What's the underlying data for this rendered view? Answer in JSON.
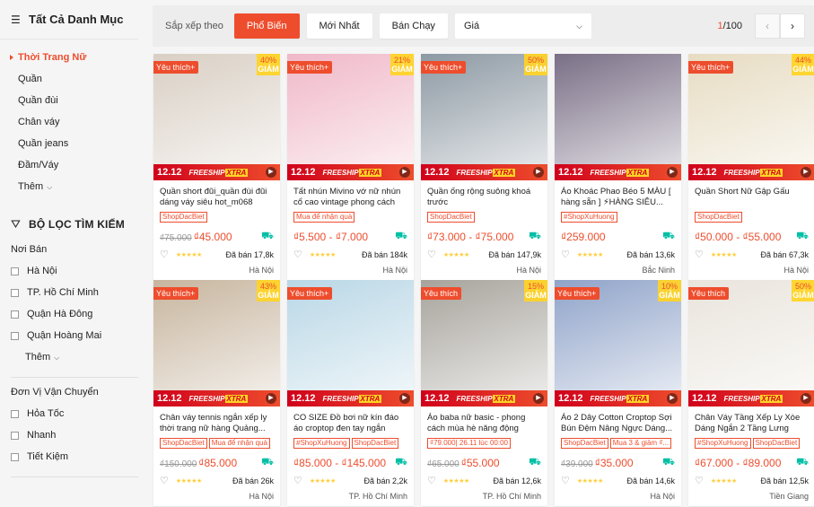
{
  "sidebar": {
    "all_categories": "Tất Cả Danh Mục",
    "categories": [
      "Thời Trang Nữ",
      "Quần",
      "Quần đùi",
      "Chân váy",
      "Quần jeans",
      "Đầm/Váy"
    ],
    "more": "Thêm",
    "filter_title": "BỘ LỌC TÌM KIẾM",
    "location_title": "Nơi Bán",
    "locations": [
      "Hà Nội",
      "TP. Hồ Chí Minh",
      "Quận Hà Đông",
      "Quận Hoàng Mai"
    ],
    "shipping_title": "Đơn Vị Vận Chuyển",
    "shipping": [
      "Hỏa Tốc",
      "Nhanh",
      "Tiết Kiệm"
    ]
  },
  "sortbar": {
    "label": "Sắp xếp theo",
    "options": [
      "Phổ Biến",
      "Mới Nhất",
      "Bán Chạy"
    ],
    "price": "Giá",
    "page_current": "1",
    "page_total": "/100"
  },
  "colors": {
    "accent": "#ee4d2d",
    "gold": "#ffd424",
    "teal": "#00bfa5"
  },
  "products": [
    {
      "badge": "Yêu thích+",
      "disc": "40%",
      "name": "Quần short đũi_quần đùi đũi dáng váy siêu hot_m068",
      "tags": [
        "ShopDacBiet"
      ],
      "old": "₫75.000",
      "price": "₫45.000",
      "sold": "Đã bán 17,8k",
      "loc": "Hà Nội",
      "promo": true,
      "bg": "#d9cfc4"
    },
    {
      "badge": "Yêu thích+",
      "disc": "21%",
      "name": "Tất nhún Mivino vớ nữ nhún cổ cao vintage phong cách Hàn...",
      "tags": [
        "Mua để nhận quà"
      ],
      "old": "",
      "price": "₫5.500 - ₫7.000",
      "sold": "Đã bán 184k",
      "loc": "Hà Nội",
      "promo": true,
      "bg": "#f0b8c8"
    },
    {
      "badge": "Yêu thích+",
      "disc": "50%",
      "name": "Quần ống rộng suông khoá trước",
      "tags": [
        "ShopDacBiet"
      ],
      "old": "",
      "price": "₫73.000 - ₫75.000",
      "sold": "Đã bán 147,9k",
      "loc": "Hà Nội",
      "promo": true,
      "bg": "#8d99a3"
    },
    {
      "badge": "",
      "disc": "",
      "name": "Áo Khoác Phao Béo 5 MÀU [ hàng sẵn ] ⚡HÀNG SIÊU...",
      "tags": [
        "#ShopXuHuong"
      ],
      "old": "",
      "price": "₫259.000",
      "sold": "Đã bán 13,6k",
      "loc": "Bắc Ninh",
      "promo": true,
      "bg": "#7a6f86"
    },
    {
      "badge": "Yêu thích+",
      "disc": "44%",
      "name": "Quần Short Nữ Gập Gấu",
      "tags": [
        "ShopDacBiet"
      ],
      "old": "",
      "price": "₫50.000 - ₫55.000",
      "sold": "Đã bán 67,3k",
      "loc": "Hà Nội",
      "promo": true,
      "bg": "#e7dcc2"
    },
    {
      "badge": "Yêu thích+",
      "disc": "43%",
      "name": "Chân váy tennis ngắn xếp ly thời trang nữ hàng Quảng...",
      "tags": [
        "ShopDacBiet",
        "Mua để nhận quà"
      ],
      "old": "₫150.000",
      "price": "₫85.000",
      "sold": "Đã bán 26k",
      "loc": "Hà Nội",
      "promo": true,
      "bg": "#c7b59e"
    },
    {
      "badge": "Yêu thích+",
      "disc": "",
      "name": "CO SIZE Đồ bơi nữ kín đáo áo croptop đen tay ngắn phối...",
      "tags": [
        "#ShopXuHuong",
        "ShopDacBiet"
      ],
      "old": "",
      "price": "₫85.000 - ₫145.000",
      "sold": "Đã bán 2,2k",
      "loc": "TP. Hồ Chí Minh",
      "promo": true,
      "bg": "#b9d7e6"
    },
    {
      "badge": "Yêu thích",
      "disc": "15%",
      "name": "Áo baba nữ basic - phong cách mùa hè năng động",
      "tags": [
        "₫79.000| 26.11 lúc 00:00"
      ],
      "old": "₫65.000",
      "price": "₫55.000",
      "sold": "Đã bán 12,6k",
      "loc": "TP. Hồ Chí Minh",
      "promo": true,
      "bg": "#a7a39c"
    },
    {
      "badge": "Yêu thích+",
      "disc": "10%",
      "name": "Áo 2 Dây Cotton Croptop Sợi Bún Đệm Nâng Ngực Dáng...",
      "tags": [
        "ShopDacBiet",
        "Mua 3 & giảm ₫..."
      ],
      "old": "₫39.000",
      "price": "₫35.000",
      "sold": "Đã bán 14,6k",
      "loc": "Hà Nội",
      "promo": true,
      "bg": "#8fa3c9"
    },
    {
      "badge": "Yêu thích",
      "disc": "50%",
      "name": "Chân Váy Tầng Xếp Ly Xòe Dáng Ngắn 2 Tầng Lưng Ca...",
      "tags": [
        "#ShopXuHuong",
        "ShopDacBiet"
      ],
      "old": "",
      "price": "₫67.000 - ₫89.000",
      "sold": "Đã bán 12,5k",
      "loc": "Tiền Giang",
      "promo": true,
      "bg": "#e9e4dc"
    }
  ],
  "promo_labels": {
    "date": "12.12",
    "freeship": "FREESHIP",
    "xtra": "XTRA"
  }
}
